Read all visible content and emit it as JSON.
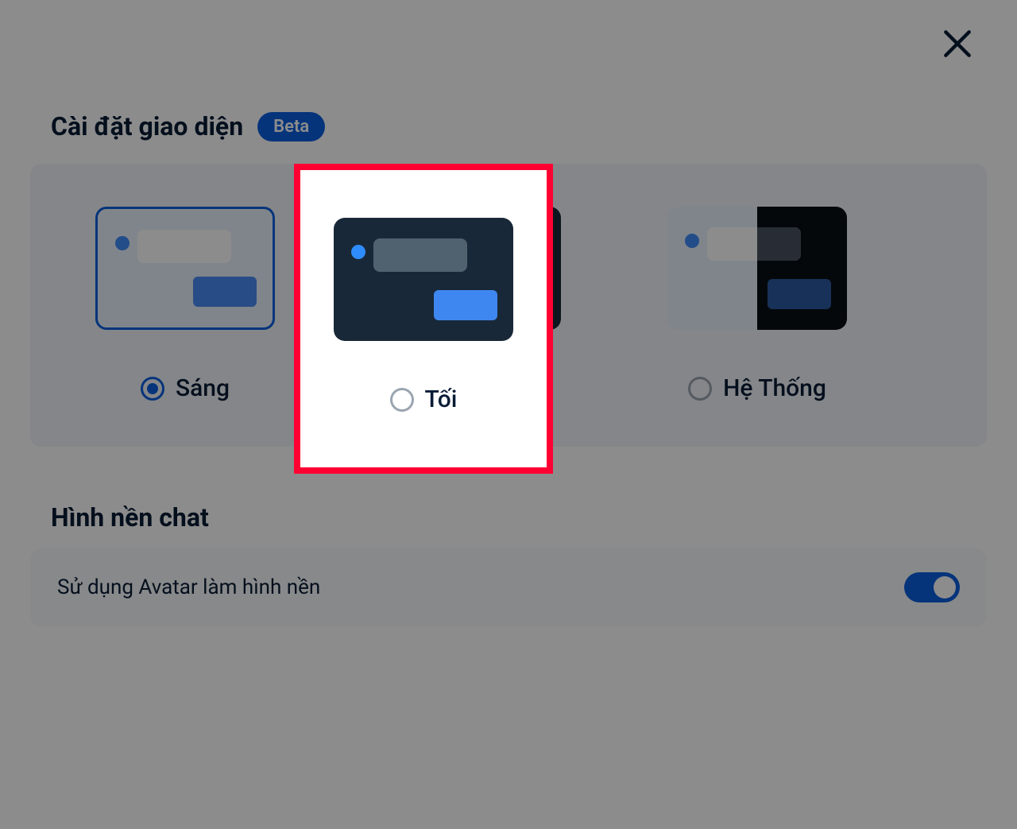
{
  "header": {
    "title": "Cài đặt giao diện",
    "badge": "Beta"
  },
  "themes": {
    "light": {
      "label": "Sáng",
      "selected": true
    },
    "dark": {
      "label": "Tối",
      "selected": false
    },
    "system": {
      "label": "Hệ Thống",
      "selected": false
    }
  },
  "background_section": {
    "title": "Hình nền chat",
    "avatar_toggle_label": "Sử dụng Avatar làm hình nền",
    "avatar_toggle_on": true
  },
  "colors": {
    "accent": "#0B5FE0",
    "highlight": "#FF0033"
  }
}
